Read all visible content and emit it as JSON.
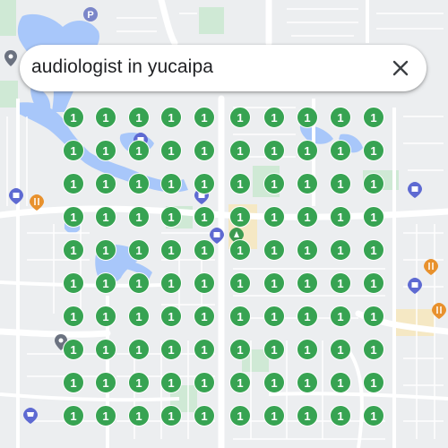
{
  "search": {
    "query": "audiologist in yucaipa",
    "close_label": "close"
  },
  "map": {
    "marker_label": "1",
    "marker_count": 100,
    "marker_color": "#37a352",
    "water_color": "#a8c7fa",
    "park_color": "#cfe9d5",
    "road_color": "#ffffff"
  },
  "pois": [
    {
      "name": "parking-icon",
      "glyph": "P"
    },
    {
      "name": "shopping-bag-icon",
      "glyph": "bag"
    },
    {
      "name": "restaurant-icon",
      "glyph": "fork-knife"
    },
    {
      "name": "shopping-bag-icon",
      "glyph": "bag"
    },
    {
      "name": "park-icon",
      "glyph": "tree"
    },
    {
      "name": "shopping-bag-icon",
      "glyph": "bag"
    },
    {
      "name": "restaurant-icon",
      "glyph": "fork-knife"
    },
    {
      "name": "restaurant-icon",
      "glyph": "fork-knife"
    },
    {
      "name": "shopping-cart-icon",
      "glyph": "cart"
    },
    {
      "name": "shopping-bag-icon",
      "glyph": "bag"
    }
  ]
}
